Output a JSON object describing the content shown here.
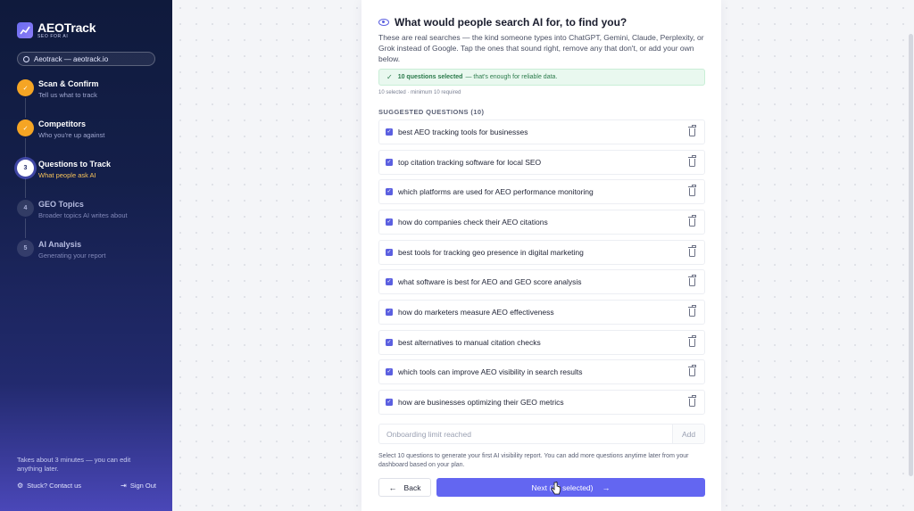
{
  "brand": {
    "name": "AEOTrack",
    "tagline": "SEO FOR AI"
  },
  "project": {
    "label": "Aeotrack — aeotrack.io"
  },
  "steps": [
    {
      "number": "1",
      "title": "Scan & Confirm",
      "subtitle": "Tell us what to track",
      "status": "done"
    },
    {
      "number": "2",
      "title": "Competitors",
      "subtitle": "Who you're up against",
      "status": "done"
    },
    {
      "number": "3",
      "title": "Questions to Track",
      "subtitle": "What people ask AI",
      "status": "active"
    },
    {
      "number": "4",
      "title": "GEO Topics",
      "subtitle": "Broader topics AI writes about",
      "status": "todo"
    },
    {
      "number": "5",
      "title": "AI Analysis",
      "subtitle": "Generating your report",
      "status": "todo"
    }
  ],
  "sidebar_footer": {
    "note": "Takes about 3 minutes — you can edit anything later.",
    "help": "Stuck? Contact us",
    "signout": "Sign Out"
  },
  "main": {
    "title": "What would people search AI for, to find you?",
    "description": "These are real searches — the kind someone types into ChatGPT, Gemini, Claude, Perplexity, or Grok instead of Google. Tap the ones that sound right, remove any that don't, or add your own below.",
    "success_bold": "10 questions selected",
    "success_rest": "— that's enough for reliable data.",
    "selected_count": "10 selected · minimum 10 required",
    "section_label": "SUGGESTED QUESTIONS (10)",
    "questions": [
      "best AEO tracking tools for businesses",
      "top citation tracking software for local SEO",
      "which platforms are used for AEO performance monitoring",
      "how do companies check their AEO citations",
      "best tools for tracking geo presence in digital marketing",
      "what software is best for AEO and GEO score analysis",
      "how do marketers measure AEO effectiveness",
      "best alternatives to manual citation checks",
      "which tools can improve AEO visibility in search results",
      "how are businesses optimizing their GEO metrics"
    ],
    "add_placeholder": "Onboarding limit reached",
    "add_label": "Add",
    "footer_note": "Select 10 questions to generate your first AI visibility report. You can add more questions anytime later from your dashboard based on your plan.",
    "back_label": "Back",
    "next_label": "Next (10 selected)"
  },
  "colors": {
    "accent": "#6366f1",
    "done": "#f5a524",
    "success_bg": "#e9f8ef"
  },
  "icons": {
    "check": "✓",
    "back_arrow": "←",
    "next_arrow": "→",
    "help": "⚙",
    "signout": "⇥"
  }
}
